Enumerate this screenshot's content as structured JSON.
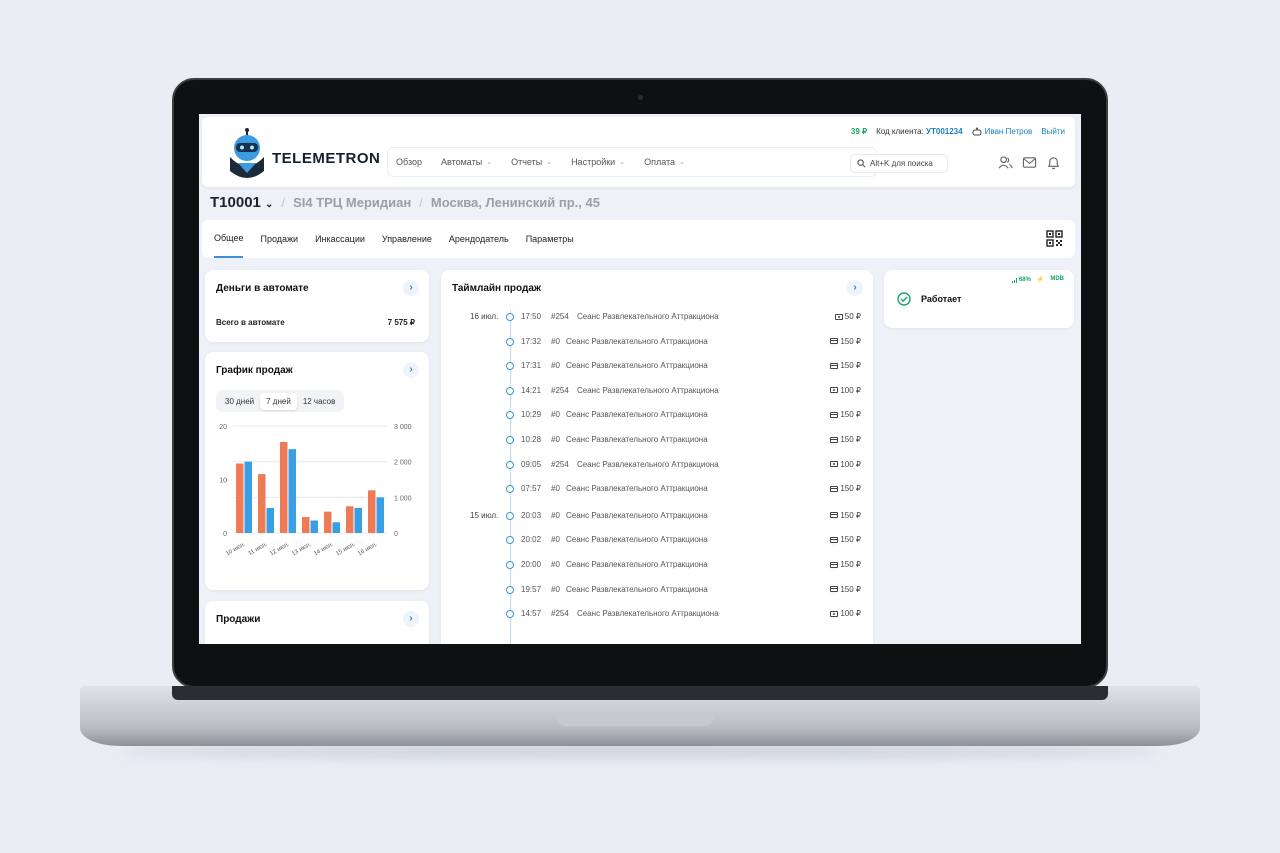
{
  "header": {
    "logo_text": "TELEMETRON",
    "balance": "39 ₽",
    "client_code_label": "Код клиента:",
    "client_code": "УТ001234",
    "user_name": "Иван Петров",
    "logout": "Выйти",
    "nav": [
      {
        "label": "Обзор",
        "dropdown": false
      },
      {
        "label": "Автоматы",
        "dropdown": true
      },
      {
        "label": "Отчеты",
        "dropdown": true
      },
      {
        "label": "Настройки",
        "dropdown": true
      },
      {
        "label": "Оплата",
        "dropdown": true
      }
    ],
    "search_label": "Alt+K для поиска"
  },
  "breadcrumb": {
    "machine": "T10001",
    "location": "SI4 ТРЦ Меридиан",
    "address": "Москва, Ленинский пр., 45"
  },
  "tabs": [
    "Общее",
    "Продажи",
    "Инкассации",
    "Управление",
    "Арендодатель",
    "Параметры"
  ],
  "money": {
    "title": "Деньги в автомате",
    "total_label": "Всего в автомате",
    "total_value": "7 575 ₽"
  },
  "sales_chart": {
    "title": "График продаж",
    "periods": [
      "30 дней",
      "7 дней",
      "12 часов"
    ],
    "active_period": "7 дней"
  },
  "sales": {
    "title": "Продажи"
  },
  "timeline": {
    "title": "Таймлайн продаж",
    "rows": [
      {
        "date": "16 июл.",
        "time": "17:50",
        "num": "#254",
        "desc": "Сеанс Развлекательного Аттракциона",
        "price": "50 ₽",
        "pay": "cash"
      },
      {
        "date": "",
        "time": "17:32",
        "num": "#0",
        "desc": "Сеанс Развлекательного Аттракциона",
        "price": "150 ₽",
        "pay": "card"
      },
      {
        "date": "",
        "time": "17:31",
        "num": "#0",
        "desc": "Сеанс Развлекательного Аттракциона",
        "price": "150 ₽",
        "pay": "card"
      },
      {
        "date": "",
        "time": "14:21",
        "num": "#254",
        "desc": "Сеанс Развлекательного Аттракциона",
        "price": "100 ₽",
        "pay": "cash"
      },
      {
        "date": "",
        "time": "10:29",
        "num": "#0",
        "desc": "Сеанс Развлекательного Аттракциона",
        "price": "150 ₽",
        "pay": "card"
      },
      {
        "date": "",
        "time": "10:28",
        "num": "#0",
        "desc": "Сеанс Развлекательного Аттракциона",
        "price": "150 ₽",
        "pay": "card"
      },
      {
        "date": "",
        "time": "09:05",
        "num": "#254",
        "desc": "Сеанс Развлекательного Аттракциона",
        "price": "100 ₽",
        "pay": "cash"
      },
      {
        "date": "",
        "time": "07:57",
        "num": "#0",
        "desc": "Сеанс Развлекательного Аттракциона",
        "price": "150 ₽",
        "pay": "card"
      },
      {
        "date": "15 июл.",
        "time": "20:03",
        "num": "#0",
        "desc": "Сеанс Развлекательного Аттракциона",
        "price": "150 ₽",
        "pay": "card"
      },
      {
        "date": "",
        "time": "20:02",
        "num": "#0",
        "desc": "Сеанс Развлекательного Аттракциона",
        "price": "150 ₽",
        "pay": "card"
      },
      {
        "date": "",
        "time": "20:00",
        "num": "#0",
        "desc": "Сеанс Развлекательного Аттракциона",
        "price": "150 ₽",
        "pay": "card"
      },
      {
        "date": "",
        "time": "19:57",
        "num": "#0",
        "desc": "Сеанс Развлекательного Аттракциона",
        "price": "150 ₽",
        "pay": "card"
      },
      {
        "date": "",
        "time": "14:57",
        "num": "#254",
        "desc": "Сеанс Развлекательного Аттракциона",
        "price": "100 ₽",
        "pay": "cash"
      }
    ]
  },
  "status": {
    "signal": "68%",
    "protocol": "MDB",
    "text": "Работает"
  },
  "colors": {
    "accent": "#3e8ede",
    "orange": "#ee7b55",
    "blue": "#3a9ee4",
    "green": "#1aa56a"
  },
  "chart_data": {
    "type": "bar",
    "categories": [
      "10 июл.",
      "11 июл.",
      "12 июл.",
      "13 июл.",
      "14 июл.",
      "15 июл.",
      "16 июл."
    ],
    "series": [
      {
        "values": [
          13,
          11,
          17,
          3,
          4,
          5,
          8
        ],
        "axis": "left"
      },
      {
        "values": [
          2000,
          700,
          2350,
          350,
          300,
          700,
          1000
        ],
        "axis": "right"
      }
    ],
    "y_left": {
      "ticks": [
        "20",
        "10",
        "0"
      ],
      "min": 0,
      "max": 20
    },
    "y_right": {
      "ticks": [
        "3 000",
        "2 000",
        "1 000",
        "0"
      ],
      "min": 0,
      "max": 3000
    }
  }
}
